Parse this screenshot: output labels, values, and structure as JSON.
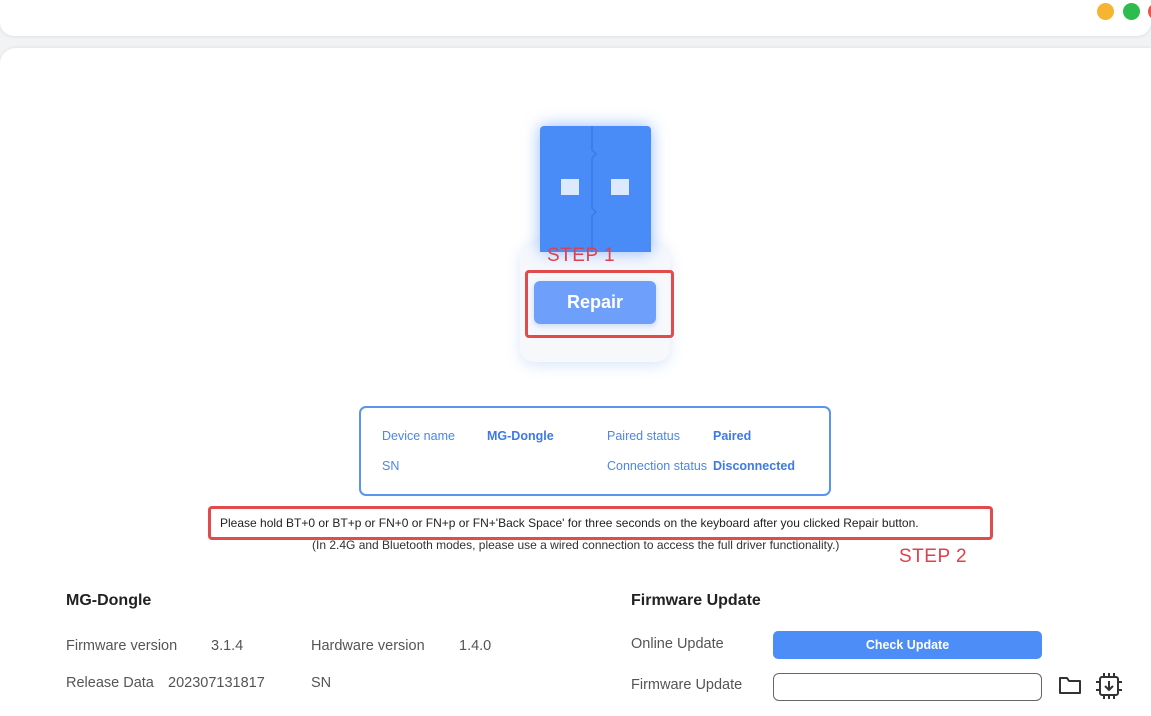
{
  "window": {
    "controls": [
      {
        "name": "minimize",
        "color": "#f5b533"
      },
      {
        "name": "maximize",
        "color": "#2dbd4e"
      },
      {
        "name": "close",
        "color": "#e8554e"
      }
    ]
  },
  "dongle": {
    "icon": "usb-dongle-icon",
    "accent": "#4a8cf7"
  },
  "annotations": {
    "step1": "STEP 1",
    "step2": "STEP 2",
    "color": "#e04b4b"
  },
  "repair": {
    "label": "Repair"
  },
  "device_info": {
    "device_name_label": "Device name",
    "device_name_value": "MG-Dongle",
    "paired_status_label": "Paired status",
    "paired_status_value": "Paired",
    "sn_label": "SN",
    "sn_value": "",
    "connection_status_label": "Connection status",
    "connection_status_value": "Disconnected"
  },
  "notices": {
    "instruction": "Please hold BT+0 or BT+p or FN+0 or FN+p or FN+'Back Space' for three seconds on the keyboard after you clicked Repair button.",
    "wired_note": "(In 2.4G and Bluetooth modes, please use a wired connection to access the full driver functionality.)"
  },
  "device_section": {
    "title": "MG-Dongle",
    "firmware_version_label": "Firmware version",
    "firmware_version_value": "3.1.4",
    "hardware_version_label": "Hardware version",
    "hardware_version_value": "1.4.0",
    "release_data_label": "Release Data",
    "release_data_value": "202307131817",
    "sn_label": "SN",
    "sn_value": ""
  },
  "firmware_update": {
    "title": "Firmware Update",
    "online_update_label": "Online Update",
    "check_update_button": "Check Update",
    "firmware_update_label": "Firmware Update",
    "file_path_value": "",
    "folder_icon": "folder-icon",
    "flash_icon": "chip-download-icon"
  }
}
